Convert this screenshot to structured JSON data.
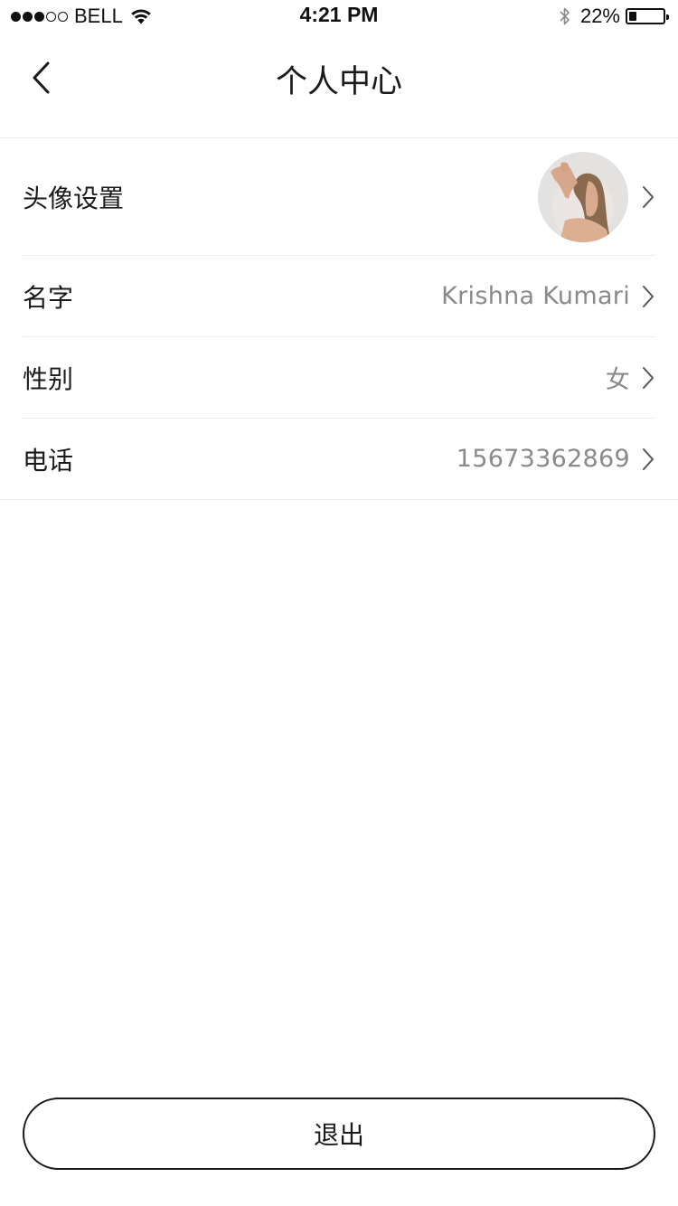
{
  "status_bar": {
    "carrier": "BELL",
    "time": "4:21 PM",
    "battery_percent": "22%",
    "battery_level": 0.22,
    "signal_bars_filled": 3,
    "signal_bars_total": 5
  },
  "nav": {
    "title": "个人中心",
    "back_icon": "chevron-left-icon"
  },
  "profile": {
    "avatar": {
      "label": "头像设置",
      "icon": "chevron-right-icon"
    },
    "name": {
      "label": "名字",
      "value": "Krishna Kumari"
    },
    "gender": {
      "label": "性别",
      "value": "女"
    },
    "phone": {
      "label": "电话",
      "value": "15673362869"
    }
  },
  "logout": {
    "label": "退出"
  },
  "colors": {
    "text_primary": "#1a1a1a",
    "text_secondary": "#8a8a8a",
    "divider": "#ececec",
    "background": "#ffffff"
  }
}
